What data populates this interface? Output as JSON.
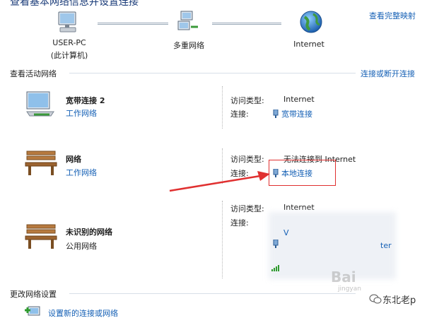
{
  "header": {
    "title": "查看基本网络信息并设置连接",
    "full_map_link": "查看完整映射"
  },
  "map": {
    "computer_name": "USER-PC",
    "computer_sub": "(此计算机)",
    "middle_label": "多重网络",
    "internet_label": "Internet"
  },
  "active_section": {
    "title": "查看活动网络",
    "connect_link": "连接或断开连接"
  },
  "networks": [
    {
      "name": "宽带连接 2",
      "type": "工作网络",
      "access_label": "访问类型:",
      "access_value": "Internet",
      "conn_label": "连接:",
      "conn_value": "宽带连接"
    },
    {
      "name": "网络",
      "type": "工作网络",
      "access_label": "访问类型:",
      "access_value": "无法连接到 Internet",
      "conn_label": "连接:",
      "conn_value": "本地连接"
    },
    {
      "name": "未识别的网络",
      "type": "公用网络",
      "access_label": "访问类型:",
      "access_value": "Internet",
      "conn_label": "连接:",
      "conn_value_1": "V",
      "conn_value_2": "ter"
    }
  ],
  "change_section": {
    "title": "更改网络设置",
    "setup_link": "设置新的连接或网络"
  },
  "watermark": {
    "baidu": "Bai",
    "brand": "东北老p",
    "jingyan": "jingyan"
  },
  "colors": {
    "link": "#1560b5",
    "annotation_red": "#e03030"
  }
}
